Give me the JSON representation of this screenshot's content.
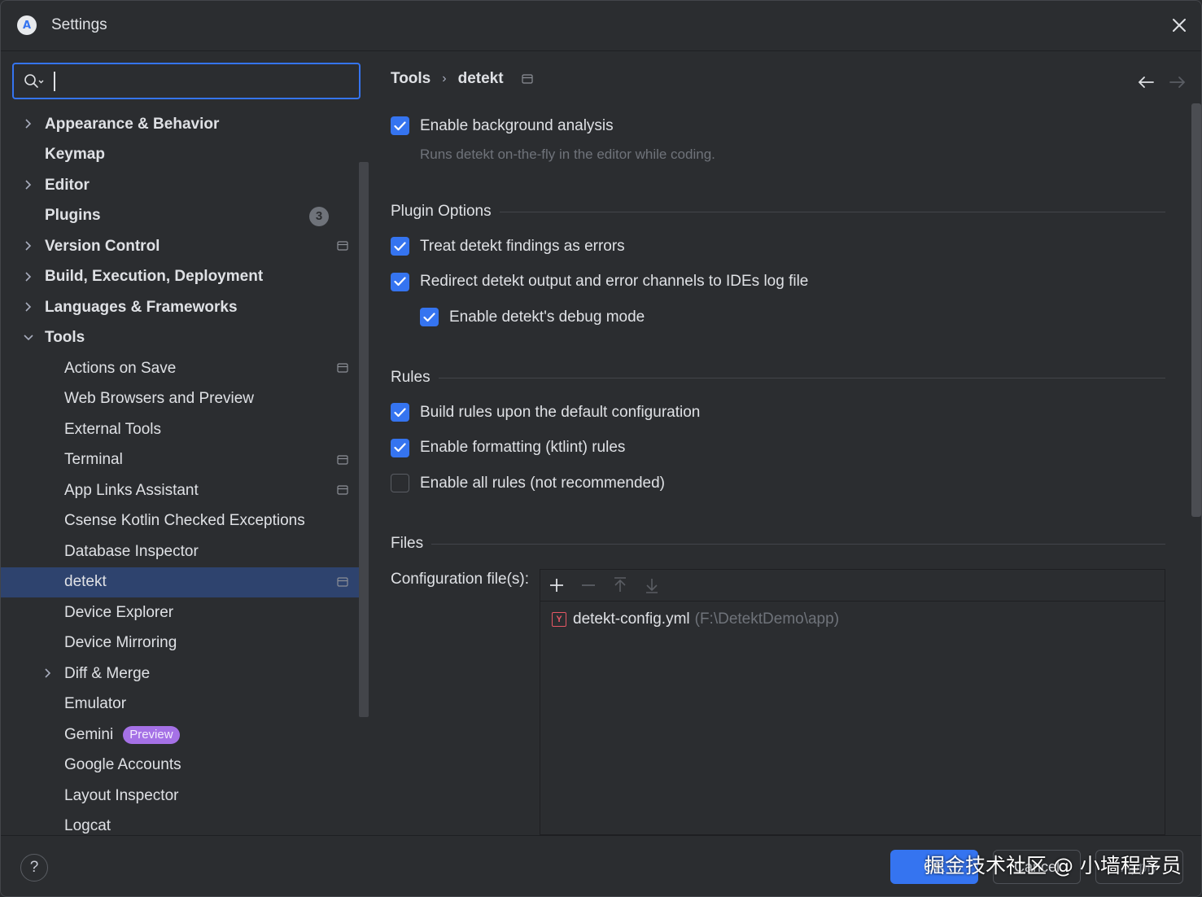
{
  "window": {
    "title": "Settings",
    "logo_letter": "A"
  },
  "search": {
    "value": "",
    "placeholder": ""
  },
  "sidebar": {
    "items": [
      {
        "label": "Appearance & Behavior",
        "expand": "collapsed",
        "bold": true,
        "level": 0
      },
      {
        "label": "Keymap",
        "bold": true,
        "level": 0
      },
      {
        "label": "Editor",
        "expand": "collapsed",
        "bold": true,
        "level": 0
      },
      {
        "label": "Plugins",
        "bold": true,
        "level": 0,
        "badge": "3"
      },
      {
        "label": "Version Control",
        "expand": "collapsed",
        "bold": true,
        "level": 0,
        "project": true
      },
      {
        "label": "Build, Execution, Deployment",
        "expand": "collapsed",
        "bold": true,
        "level": 0
      },
      {
        "label": "Languages & Frameworks",
        "expand": "collapsed",
        "bold": true,
        "level": 0
      },
      {
        "label": "Tools",
        "expand": "expanded",
        "bold": true,
        "level": 0
      },
      {
        "label": "Actions on Save",
        "level": 1,
        "project": true
      },
      {
        "label": "Web Browsers and Preview",
        "level": 1
      },
      {
        "label": "External Tools",
        "level": 1
      },
      {
        "label": "Terminal",
        "level": 1,
        "project": true
      },
      {
        "label": "App Links Assistant",
        "level": 1,
        "project": true
      },
      {
        "label": "Csense Kotlin Checked Exceptions",
        "level": 1
      },
      {
        "label": "Database Inspector",
        "level": 1
      },
      {
        "label": "detekt",
        "level": 1,
        "project": true,
        "selected": true
      },
      {
        "label": "Device Explorer",
        "level": 1
      },
      {
        "label": "Device Mirroring",
        "level": 1
      },
      {
        "label": "Diff & Merge",
        "expand": "collapsed",
        "level": 1
      },
      {
        "label": "Emulator",
        "level": 1
      },
      {
        "label": "Gemini",
        "level": 1,
        "tag": "Preview"
      },
      {
        "label": "Google Accounts",
        "level": 1
      },
      {
        "label": "Layout Inspector",
        "level": 1
      },
      {
        "label": "Logcat",
        "level": 1
      }
    ]
  },
  "breadcrumb": {
    "parent": "Tools",
    "separator": "›",
    "current": "detekt"
  },
  "main": {
    "background_analysis": {
      "label": "Enable background analysis",
      "checked": true,
      "hint": "Runs detekt on-the-fly in the editor while coding."
    },
    "plugin_options": {
      "title": "Plugin Options",
      "options": [
        {
          "label": "Treat detekt findings as errors",
          "checked": true
        },
        {
          "label": "Redirect detekt output and error channels to IDEs log file",
          "checked": true
        },
        {
          "label": "Enable detekt's debug mode",
          "checked": true
        }
      ]
    },
    "rules": {
      "title": "Rules",
      "options": [
        {
          "label": "Build rules upon the default configuration",
          "checked": true
        },
        {
          "label": "Enable formatting (ktlint) rules",
          "checked": true
        },
        {
          "label": "Enable all rules (not recommended)",
          "checked": false
        }
      ]
    },
    "files": {
      "title": "Files",
      "config_label": "Configuration file(s):",
      "toolbar": [
        "add-icon",
        "remove-icon",
        "move-up-icon",
        "move-down-icon"
      ],
      "entries": [
        {
          "icon_letter": "Y",
          "name": "detekt-config.yml",
          "path": "(F:\\DetektDemo\\app)"
        }
      ]
    }
  },
  "footer": {
    "help_label": "?",
    "ok_label": "OK",
    "cancel_label": "Cancel",
    "apply_label": "Apply",
    "watermark": "掘金技术社区 @ 小墙程序员"
  },
  "colors": {
    "accent": "#3574f0",
    "background": "#2b2d30",
    "selection": "#2e436e",
    "preview_tag": "#a571e6"
  }
}
